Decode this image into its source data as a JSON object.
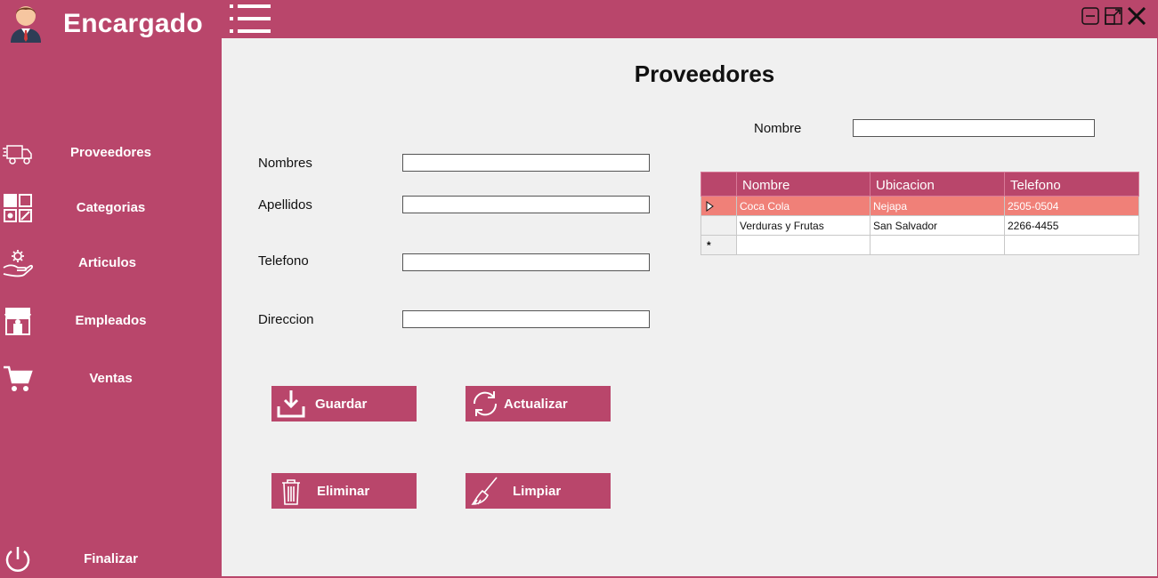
{
  "sidebar": {
    "user_title": "Encargado",
    "items": [
      {
        "label": "Proveedores",
        "icon": "truck-icon"
      },
      {
        "label": "Categorias",
        "icon": "categories-icon"
      },
      {
        "label": "Articulos",
        "icon": "hand-gear-icon"
      },
      {
        "label": "Empleados",
        "icon": "store-icon"
      },
      {
        "label": "Ventas",
        "icon": "cart-icon"
      }
    ],
    "exit_label": "Finalizar"
  },
  "main": {
    "title": "Proveedores",
    "search_label": "Nombre",
    "search_value": "",
    "form": {
      "nombres_label": "Nombres",
      "apellidos_label": "Apellidos",
      "telefono_label": "Telefono",
      "direccion_label": "Direccion",
      "nombres_value": "",
      "apellidos_value": "",
      "telefono_value": "",
      "direccion_value": ""
    },
    "buttons": {
      "guardar": "Guardar",
      "actualizar": "Actualizar",
      "eliminar": "Eliminar",
      "limpiar": "Limpiar"
    },
    "grid": {
      "columns": [
        "Nombre",
        "Ubicacion",
        "Telefono"
      ],
      "rows": [
        [
          "Coca Cola",
          "Nejapa",
          "2505-0504"
        ],
        [
          "Verduras y Frutas",
          "San Salvador",
          "2266-4455"
        ]
      ],
      "new_row_marker": "*"
    }
  },
  "colors": {
    "accent": "#b9466b",
    "selected_row": "#f08078",
    "background": "#f0f0f0"
  }
}
